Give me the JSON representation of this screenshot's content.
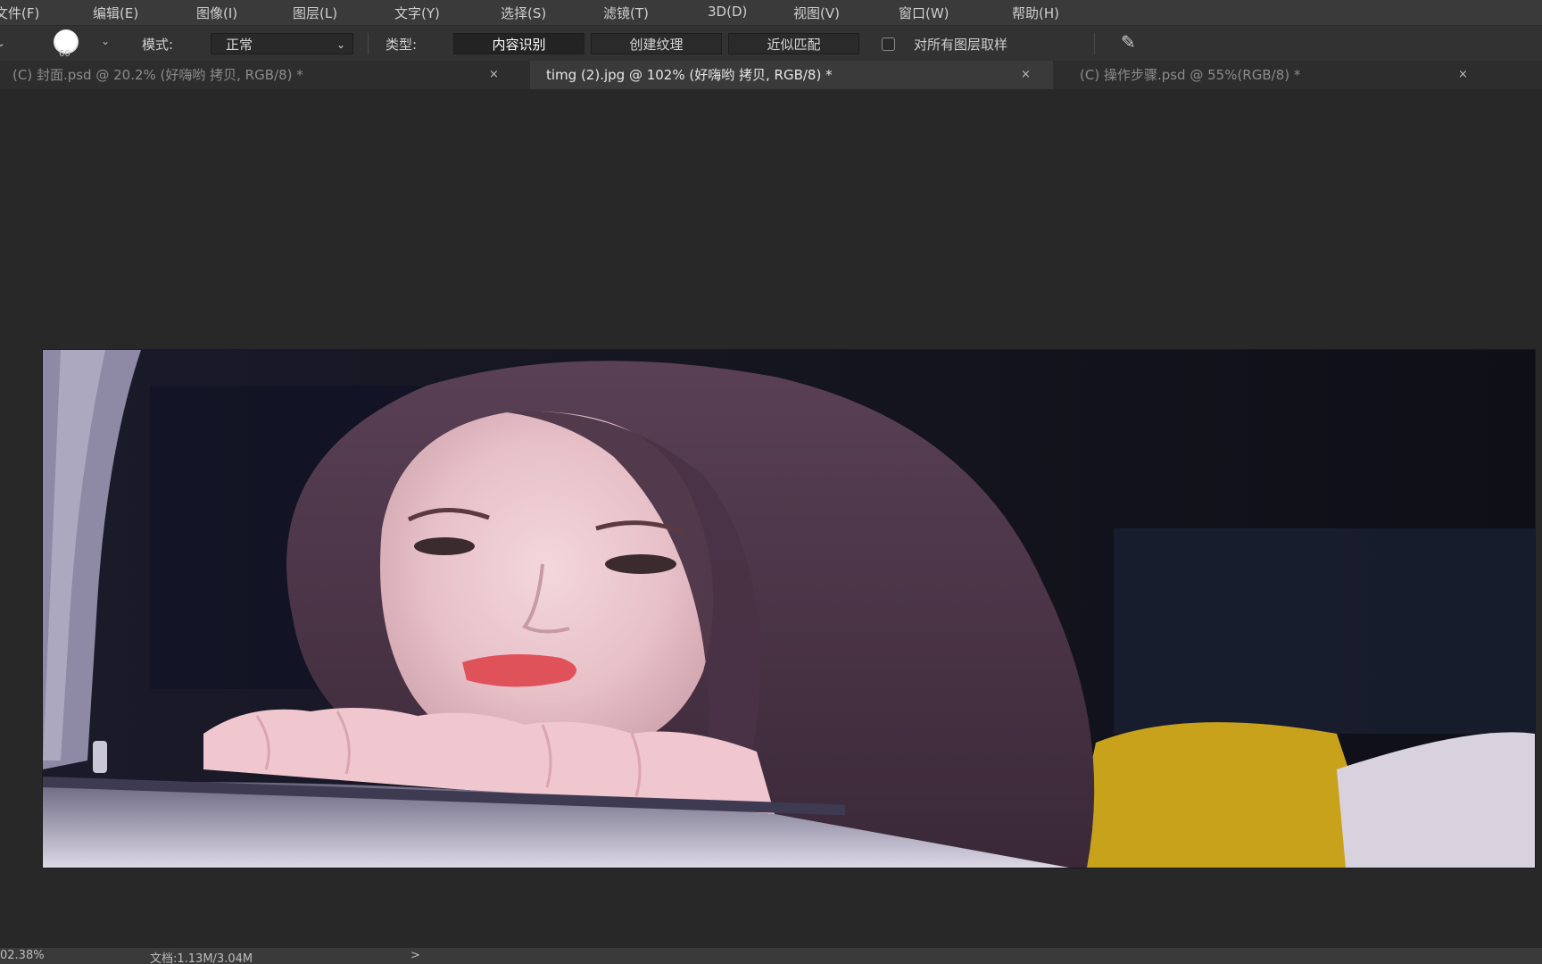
{
  "menu": {
    "items": [
      "文件(F)",
      "编辑(E)",
      "图像(I)",
      "图层(L)",
      "文字(Y)",
      "选择(S)",
      "滤镜(T)",
      "3D(D)",
      "视图(V)",
      "窗口(W)",
      "帮助(H)"
    ]
  },
  "options": {
    "brush_size": "60",
    "mode_label": "模式:",
    "mode_value": "正常",
    "type_label": "类型:",
    "type_buttons": [
      "内容识别",
      "创建纹理",
      "近似匹配"
    ],
    "sample_all_layers": "对所有图层取样"
  },
  "tabs": [
    {
      "label": "(C) 封面.psd @ 20.2% (好嗨哟 拷贝, RGB/8) *"
    },
    {
      "label": "timg (2).jpg @ 102% (好嗨哟 拷贝, RGB/8) *"
    },
    {
      "label": "(C) 操作步骤.psd @ 55%(RGB/8) *"
    }
  ],
  "status": {
    "zoom": "02.38%",
    "doc_size": "文档:1.13M/3.04M"
  },
  "icons": {
    "tab_close": "×",
    "chevron": "⌄",
    "status_arrow": ">"
  }
}
